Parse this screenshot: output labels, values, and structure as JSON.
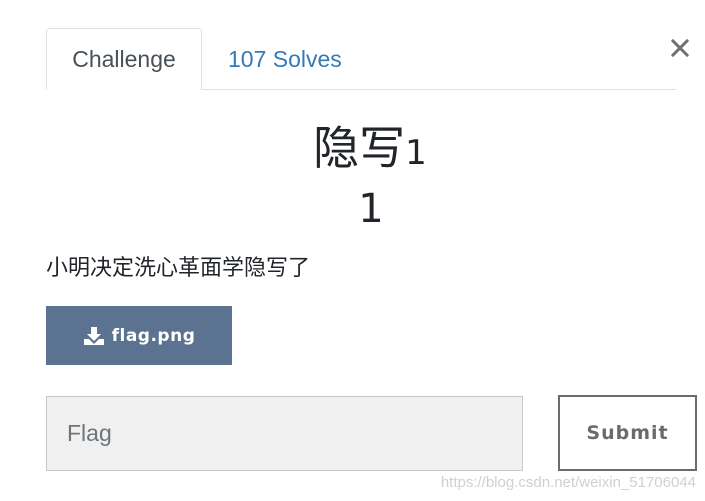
{
  "tabs": [
    {
      "label": "Challenge",
      "active": true
    },
    {
      "label": "107 Solves",
      "active": false
    }
  ],
  "close": {
    "icon": "close-icon"
  },
  "challenge": {
    "title": "隐写",
    "title_suffix": "1",
    "points": "1",
    "description": "小明决定洗心革面学隐写了"
  },
  "file": {
    "label": "flag.png",
    "icon": "download-icon"
  },
  "form": {
    "flag_placeholder": "Flag",
    "submit_label": "Submit"
  },
  "watermark": "https://blog.csdn.net/weixin_51706044",
  "colors": {
    "tab_link": "#337ab7",
    "file_button": "#5b7290",
    "input_bg": "#f0f0f0",
    "submit_border": "#6b6b6b"
  }
}
